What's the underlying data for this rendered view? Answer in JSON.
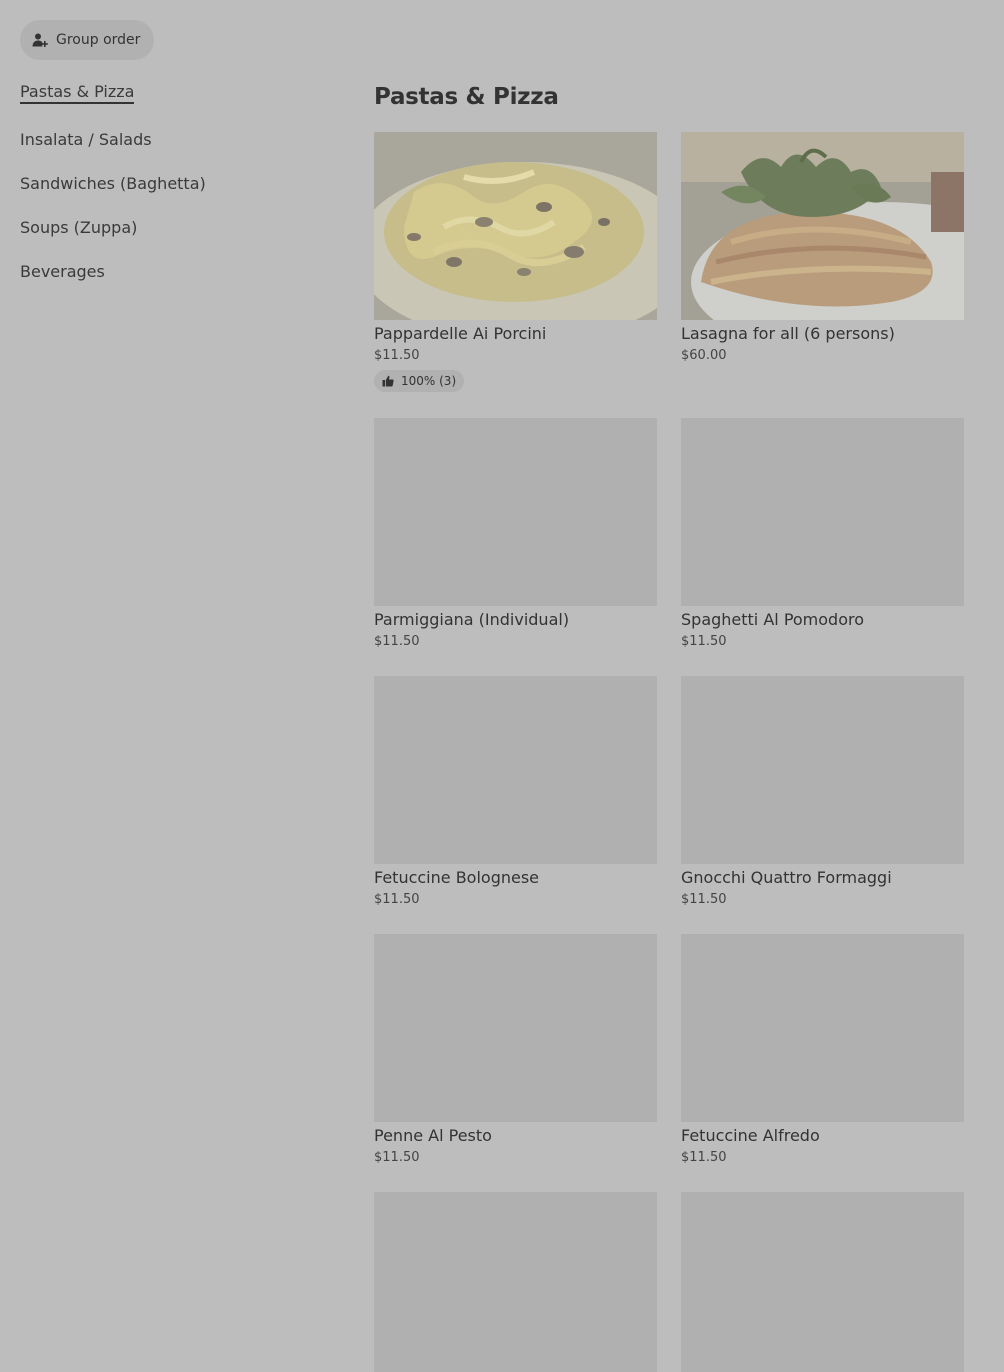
{
  "header": {
    "group_order_label": "Group order",
    "group_order_icon": "add-person-icon"
  },
  "sidebar": {
    "items": [
      {
        "label": "Pastas & Pizza",
        "active": true
      },
      {
        "label": "Insalata / Salads",
        "active": false
      },
      {
        "label": "Sandwiches (Baghetta)",
        "active": false
      },
      {
        "label": "Soups (Zuppa)",
        "active": false
      },
      {
        "label": "Beverages",
        "active": false
      }
    ]
  },
  "main": {
    "section_title": "Pastas & Pizza",
    "items": [
      {
        "name": "Pappardelle Ai Porcini",
        "price": "$11.50",
        "rating": "100% (3)",
        "rating_icon": "thumbs-up-icon",
        "image": "pasta-photo"
      },
      {
        "name": "Lasagna for all (6 persons)",
        "price": "$60.00",
        "image": "lasagna-photo"
      },
      {
        "name": "Parmiggiana (Individual)",
        "price": "$11.50"
      },
      {
        "name": "Spaghetti Al Pomodoro",
        "price": "$11.50"
      },
      {
        "name": "Fetuccine Bolognese",
        "price": "$11.50"
      },
      {
        "name": "Gnocchi Quattro Formaggi",
        "price": "$11.50"
      },
      {
        "name": "Penne Al Pesto",
        "price": "$11.50"
      },
      {
        "name": "Fetuccine Alfredo",
        "price": "$11.50"
      },
      {
        "name": "",
        "price": ""
      },
      {
        "name": "",
        "price": ""
      }
    ]
  },
  "colors": {
    "overlay_background": "#bdbdbd",
    "placeholder": "#b0b0b0",
    "text": "#333333"
  }
}
